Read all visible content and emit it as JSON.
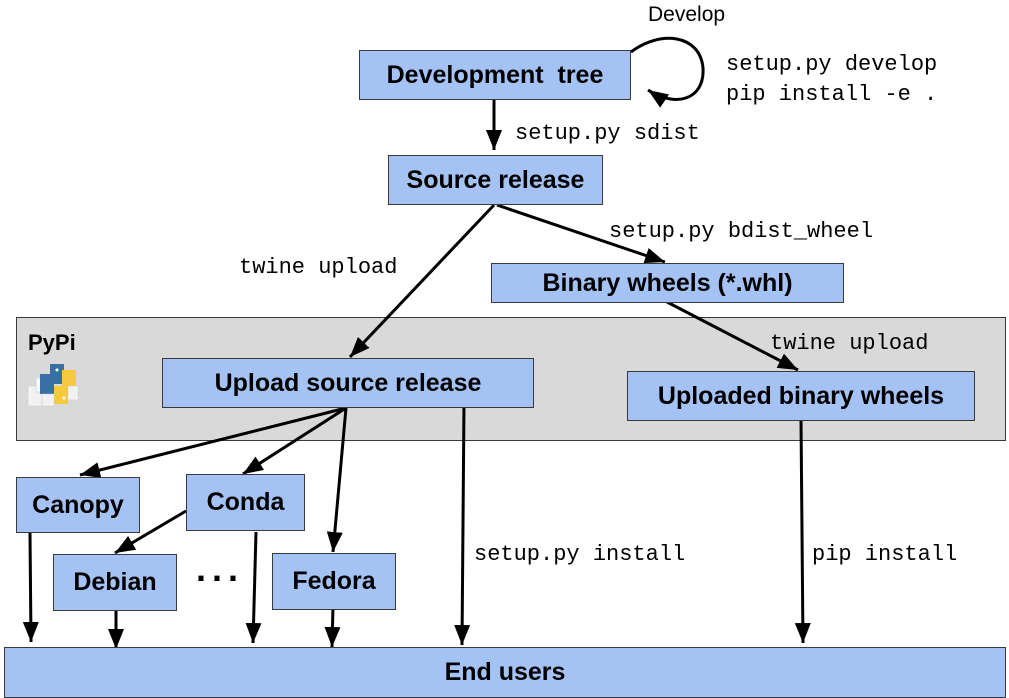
{
  "diagram": {
    "group": {
      "label": "PyPi",
      "icon": "pypi-logo-icon"
    },
    "nodes": {
      "development_tree": "Development  tree",
      "source_release": "Source release",
      "binary_wheels": "Binary wheels (*.whl)",
      "upload_source_release": "Upload source release",
      "uploaded_binary_wheels": "Uploaded binary wheels",
      "canopy": "Canopy",
      "conda": "Conda",
      "debian": "Debian",
      "fedora": "Fedora",
      "ellipsis": "...",
      "end_users": "End users"
    },
    "edge_labels": {
      "develop_loop_title": "Develop",
      "develop_loop_cmd1": "setup.py develop",
      "develop_loop_cmd2": "pip install -e .",
      "sdist": "setup.py sdist",
      "bdist_wheel": "setup.py bdist_wheel",
      "twine_upload_source": "twine upload",
      "twine_upload_wheels": "twine upload",
      "setup_install": "setup.py install",
      "pip_install": "pip install"
    },
    "edges": [
      {
        "from": "development_tree",
        "to": "development_tree",
        "label": "develop_loop"
      },
      {
        "from": "development_tree",
        "to": "source_release",
        "label": "sdist"
      },
      {
        "from": "source_release",
        "to": "binary_wheels",
        "label": "bdist_wheel"
      },
      {
        "from": "source_release",
        "to": "upload_source_release",
        "label": "twine_upload_source"
      },
      {
        "from": "binary_wheels",
        "to": "uploaded_binary_wheels",
        "label": "twine_upload_wheels"
      },
      {
        "from": "upload_source_release",
        "to": "canopy"
      },
      {
        "from": "upload_source_release",
        "to": "conda"
      },
      {
        "from": "upload_source_release",
        "to": "fedora"
      },
      {
        "from": "conda",
        "to": "debian"
      },
      {
        "from": "upload_source_release",
        "to": "end_users",
        "label": "setup_install"
      },
      {
        "from": "uploaded_binary_wheels",
        "to": "end_users",
        "label": "pip_install"
      },
      {
        "from": "canopy",
        "to": "end_users"
      },
      {
        "from": "debian",
        "to": "end_users"
      },
      {
        "from": "conda",
        "to": "end_users"
      },
      {
        "from": "fedora",
        "to": "end_users"
      }
    ]
  }
}
